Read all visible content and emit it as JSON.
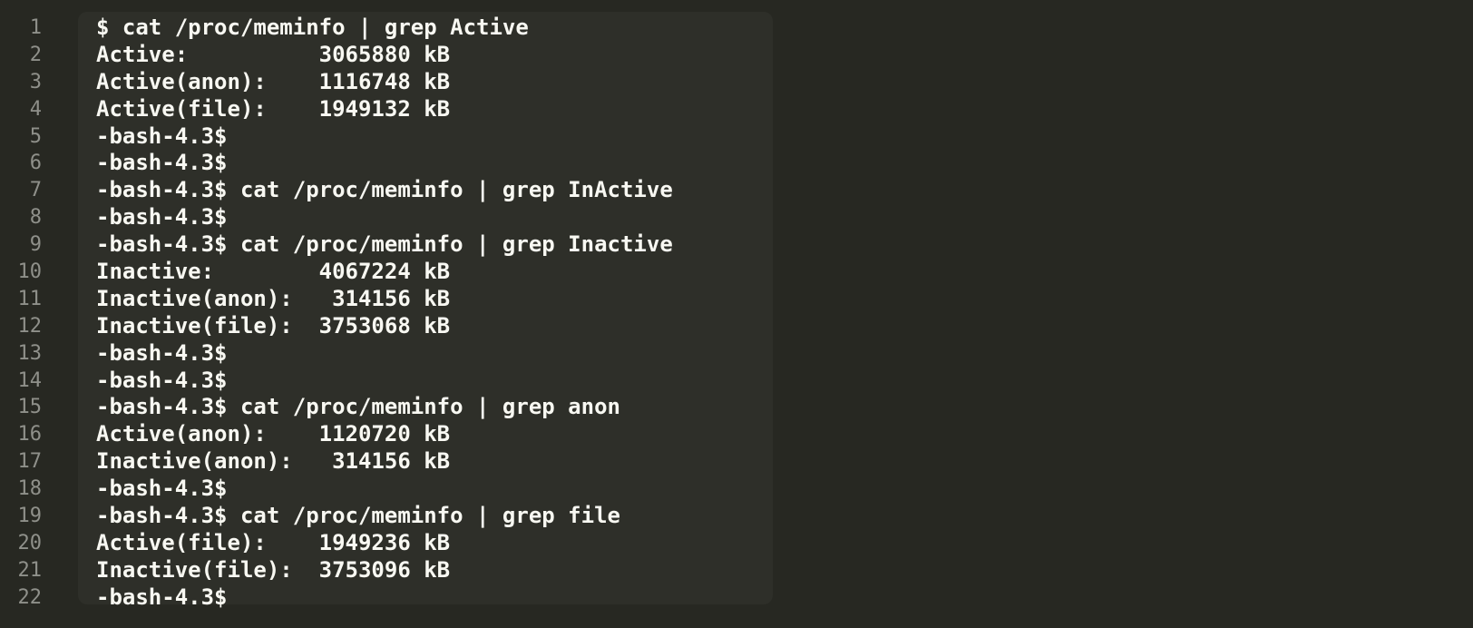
{
  "editor": {
    "lines": [
      {
        "number": "1",
        "text": "$ cat /proc/meminfo | grep Active"
      },
      {
        "number": "2",
        "text": "Active:          3065880 kB"
      },
      {
        "number": "3",
        "text": "Active(anon):    1116748 kB"
      },
      {
        "number": "4",
        "text": "Active(file):    1949132 kB"
      },
      {
        "number": "5",
        "text": "-bash-4.3$"
      },
      {
        "number": "6",
        "text": "-bash-4.3$"
      },
      {
        "number": "7",
        "text": "-bash-4.3$ cat /proc/meminfo | grep InActive"
      },
      {
        "number": "8",
        "text": "-bash-4.3$"
      },
      {
        "number": "9",
        "text": "-bash-4.3$ cat /proc/meminfo | grep Inactive"
      },
      {
        "number": "10",
        "text": "Inactive:        4067224 kB"
      },
      {
        "number": "11",
        "text": "Inactive(anon):   314156 kB"
      },
      {
        "number": "12",
        "text": "Inactive(file):  3753068 kB"
      },
      {
        "number": "13",
        "text": "-bash-4.3$"
      },
      {
        "number": "14",
        "text": "-bash-4.3$"
      },
      {
        "number": "15",
        "text": "-bash-4.3$ cat /proc/meminfo | grep anon"
      },
      {
        "number": "16",
        "text": "Active(anon):    1120720 kB"
      },
      {
        "number": "17",
        "text": "Inactive(anon):   314156 kB"
      },
      {
        "number": "18",
        "text": "-bash-4.3$"
      },
      {
        "number": "19",
        "text": "-bash-4.3$ cat /proc/meminfo | grep file"
      },
      {
        "number": "20",
        "text": "Active(file):    1949236 kB"
      },
      {
        "number": "21",
        "text": "Inactive(file):  3753096 kB"
      },
      {
        "number": "22",
        "text": "-bash-4.3$"
      }
    ]
  },
  "colors": {
    "background": "#272822",
    "block_background": "#2e2f29",
    "text": "#f8f8f2",
    "line_number": "#8f908a"
  }
}
